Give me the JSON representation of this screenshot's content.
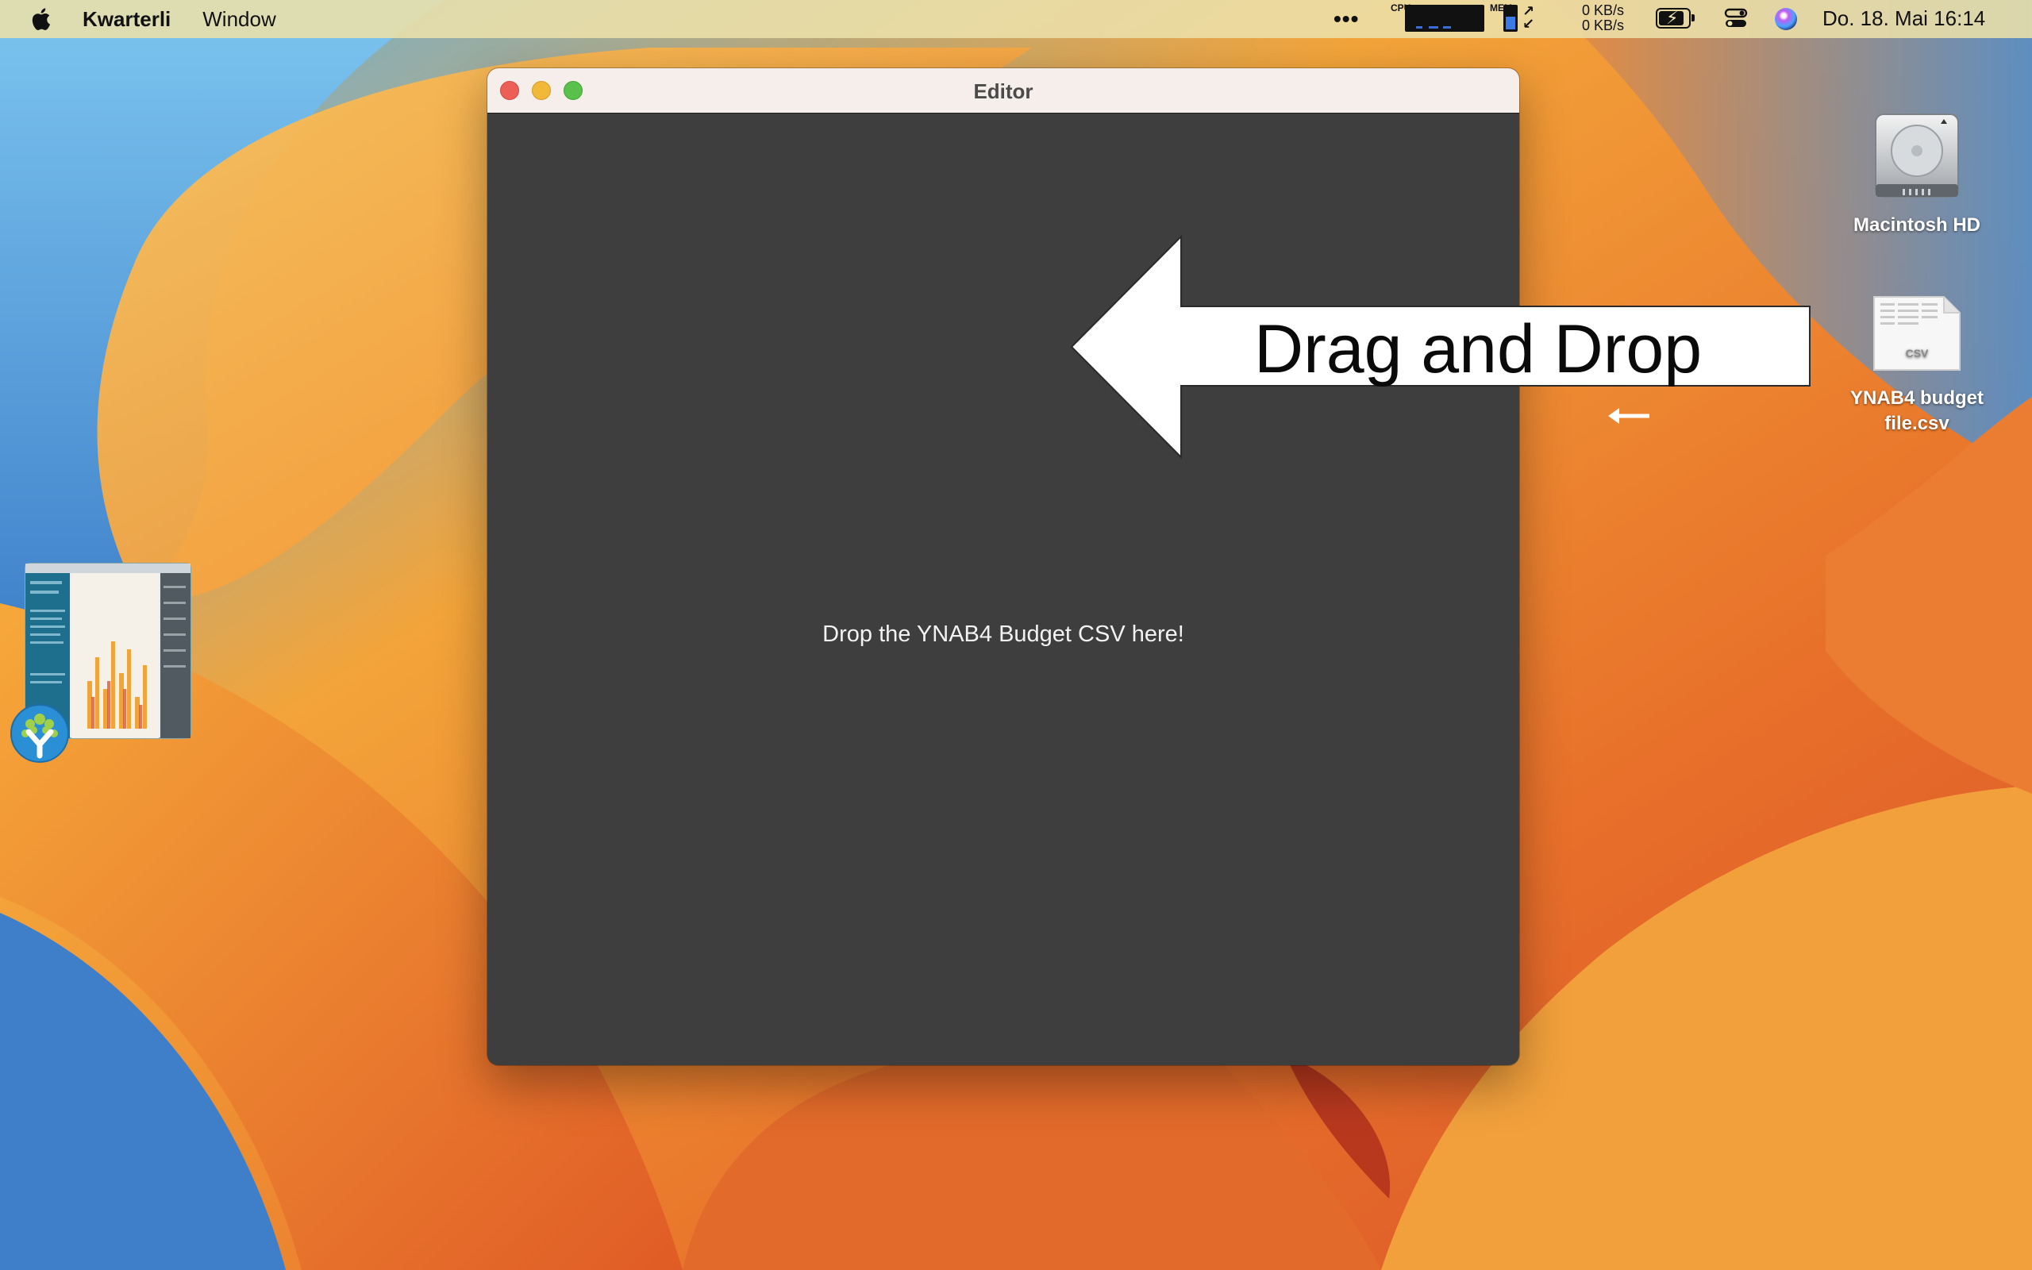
{
  "menubar": {
    "app_name": "Kwarterli",
    "menus": [
      "Window"
    ],
    "overflow": "•••",
    "cpu_label": "CPU",
    "mem_label": "MEM",
    "net_up": "0 KB/s",
    "net_down": "0 KB/s",
    "clock": "Do. 18. Mai  16:14"
  },
  "window": {
    "title": "Editor",
    "drop_prompt": "Drop the YNAB4 Budget CSV here!"
  },
  "annotation": {
    "arrow_text": "Drag and Drop"
  },
  "desktop": {
    "icons": [
      {
        "label": "Macintosh HD"
      },
      {
        "label": "YNAB4 budget file.csv",
        "badge": "CSV"
      }
    ]
  },
  "colors": {
    "window_bg": "#3e3e3e",
    "titlebar_bg": "#f6eeea",
    "close": "#ec5f57",
    "minimize": "#f1b83a",
    "maximize": "#5ac04c"
  }
}
